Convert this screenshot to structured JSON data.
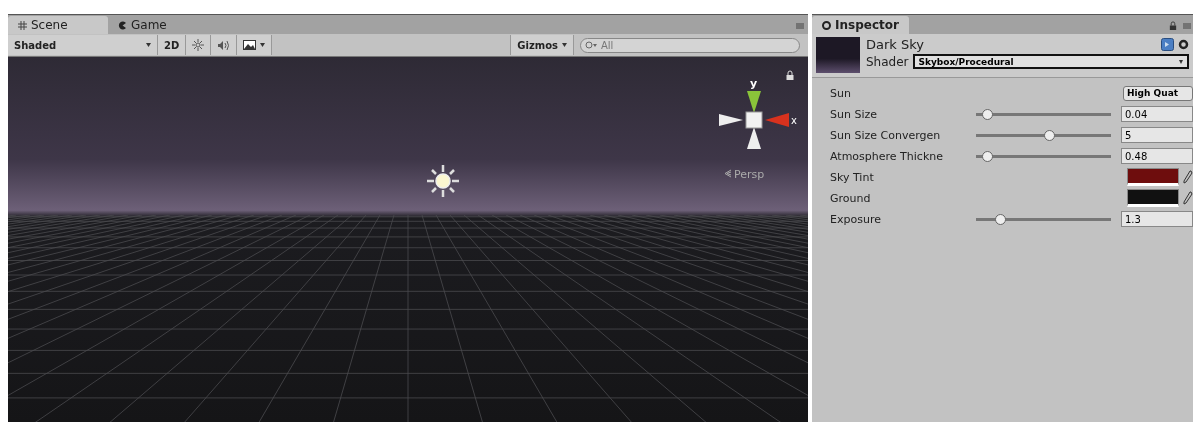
{
  "scene_panel": {
    "tabs": [
      {
        "label": "Scene",
        "selected": true
      },
      {
        "label": "Game",
        "selected": false
      }
    ],
    "toolbar": {
      "shading": "Shaded",
      "mode_2d": "2D",
      "gizmos": "Gizmos",
      "search": {
        "placeholder": "All"
      }
    },
    "viewport": {
      "axis_y": "y",
      "axis_x": "x",
      "projection": "Persp"
    }
  },
  "inspector": {
    "tab": "Inspector",
    "material": {
      "name": "Dark Sky",
      "shader_label": "Shader",
      "shader": "Skybox/Procedural"
    },
    "properties": [
      {
        "kind": "dropdown",
        "label": "Sun",
        "value": "High Quat"
      },
      {
        "kind": "slider",
        "label": "Sun Size",
        "level": 0.08,
        "value": "0.04"
      },
      {
        "kind": "slider",
        "label": "Sun Size Convergen",
        "level": 0.54,
        "value": "5"
      },
      {
        "kind": "slider",
        "label": "Atmosphere Thickne",
        "level": 0.08,
        "value": "0.48"
      },
      {
        "kind": "color",
        "label": "Sky Tint",
        "color": "#6e0d0d"
      },
      {
        "kind": "color",
        "label": "Ground",
        "color": "#111111"
      },
      {
        "kind": "slider",
        "label": "Exposure",
        "level": 0.18,
        "value": "1.3"
      }
    ]
  }
}
